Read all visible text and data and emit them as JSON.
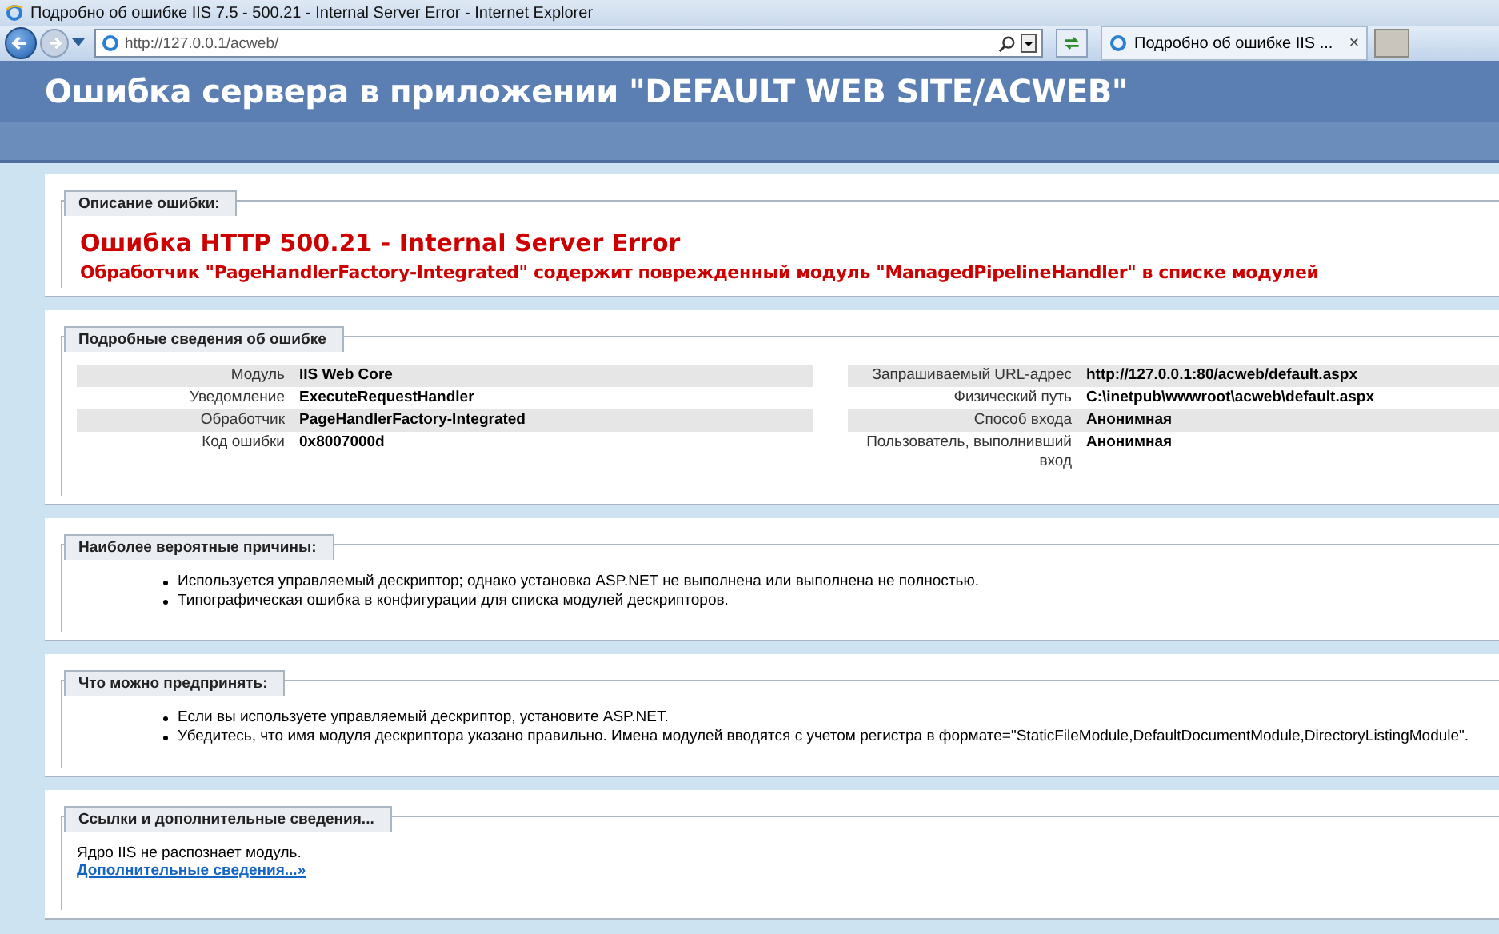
{
  "window": {
    "title": "Подробно об ошибке IIS 7.5 - 500.21 - Internal Server Error - Internet Explorer"
  },
  "address_bar": {
    "url": "http://127.0.0.1/acweb/"
  },
  "tab": {
    "label": "Подробно об ошибке IIS ...",
    "close": "×"
  },
  "page_title": "Ошибка сервера в приложении \"DEFAULT WEB SITE/ACWEB\"",
  "description": {
    "heading": "Описание ошибки:",
    "error_title": "Ошибка HTTP 500.21 - Internal Server Error",
    "error_message": "Обработчик \"PageHandlerFactory-Integrated\" содержит поврежденный модуль \"ManagedPipelineHandler\" в списке модулей"
  },
  "details": {
    "heading": "Подробные сведения об ошибке",
    "left": [
      {
        "label": "Модуль",
        "value": "IIS Web Core"
      },
      {
        "label": "Уведомление",
        "value": "ExecuteRequestHandler"
      },
      {
        "label": "Обработчик",
        "value": "PageHandlerFactory-Integrated"
      },
      {
        "label": "Код ошибки",
        "value": "0x8007000d"
      }
    ],
    "right": [
      {
        "label": "Запрашиваемый URL-адрес",
        "value": "http://127.0.0.1:80/acweb/default.aspx"
      },
      {
        "label": "Физический путь",
        "value": "C:\\inetpub\\wwwroot\\acweb\\default.aspx"
      },
      {
        "label": "Способ входа",
        "value": "Анонимная"
      },
      {
        "label": "Пользователь, выполнивший вход",
        "value": "Анонимная"
      }
    ]
  },
  "causes": {
    "heading": "Наиболее вероятные причины:",
    "items": [
      "Используется управляемый дескриптор; однако установка ASP.NET не выполнена или выполнена не полностью.",
      "Типографическая ошибка в конфигурации для списка модулей дескрипторов."
    ]
  },
  "actions": {
    "heading": "Что можно предпринять:",
    "items": [
      "Если вы используете управляемый дескриптор, установите ASP.NET.",
      "Убедитесь, что имя модуля дескриптора указано правильно. Имена модулей вводятся с учетом регистра в формате=\"StaticFileModule,DefaultDocumentModule,DirectoryListingModule\"."
    ]
  },
  "links": {
    "heading": "Ссылки и дополнительные сведения...",
    "text": "Ядро IIS не распознает модуль.",
    "link": "Дополнительные сведения...»"
  }
}
